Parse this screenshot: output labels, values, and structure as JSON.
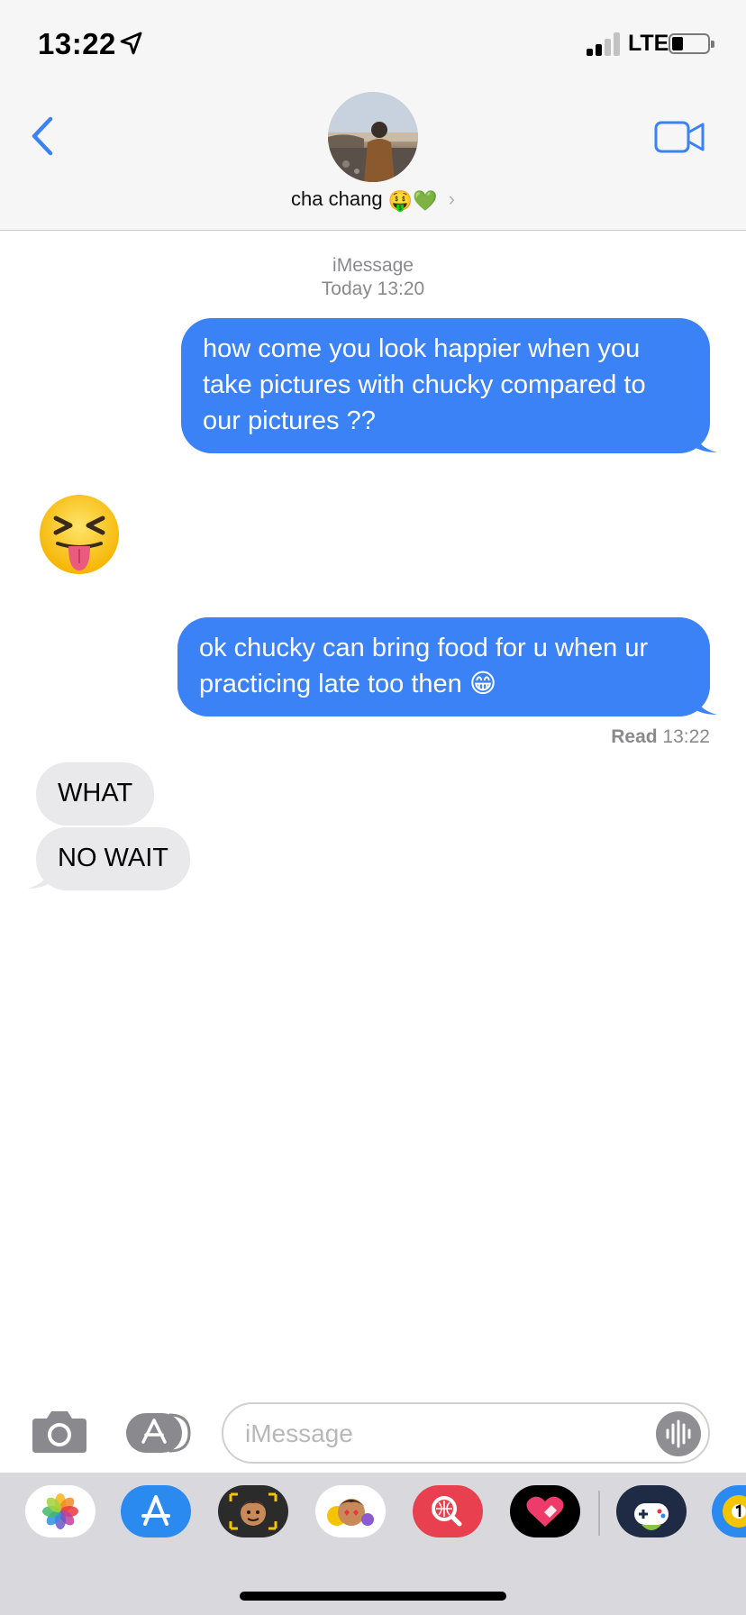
{
  "status_bar": {
    "time": "13:22",
    "network": "LTE"
  },
  "header": {
    "contact_name": "cha chang",
    "contact_emojis": "🤑💚"
  },
  "thread": {
    "service": "iMessage",
    "timestamp": "Today 13:20",
    "messages": [
      {
        "direction": "outgoing",
        "text": "how come you look happier when you take pictures with chucky compared to our pictures ??"
      },
      {
        "direction": "incoming",
        "text": "😝",
        "type": "big-emoji"
      },
      {
        "direction": "outgoing",
        "text": "ok chucky can bring food for u when ur practicing late too then 😁"
      },
      {
        "direction": "incoming",
        "text": "WHAT"
      },
      {
        "direction": "incoming",
        "text": "NO WAIT"
      }
    ],
    "read_label": "Read",
    "read_time": "13:22"
  },
  "composer": {
    "placeholder": "iMessage"
  },
  "app_drawer": {
    "apps": [
      "photos-icon",
      "app-store-icon",
      "memoji-camera-icon",
      "memoji-stickers-icon",
      "image-search-icon",
      "digital-touch-icon",
      "game-pigeon-icon",
      "pool-game-icon"
    ]
  },
  "colors": {
    "accent": "#3a82f6",
    "outgoing_bubble": "#3a82f6",
    "incoming_bubble": "#e9e9eb",
    "header_bg": "#f6f6f6",
    "meta_text": "#8a8a8e"
  }
}
